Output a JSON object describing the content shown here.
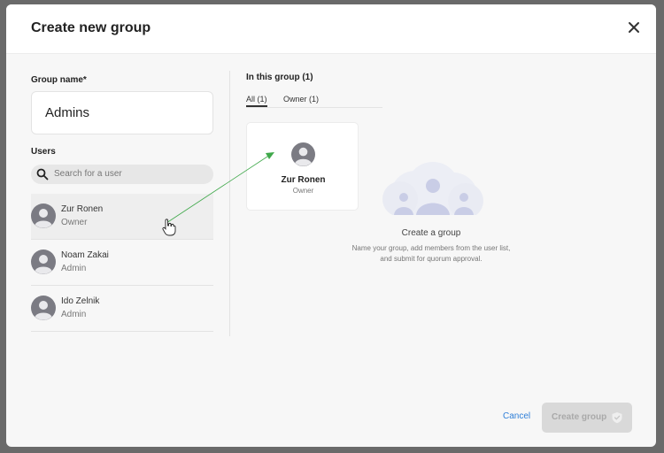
{
  "dialog": {
    "title": "Create new group",
    "group_name_label": "Group name*",
    "group_name_value": "Admins",
    "users_label": "Users",
    "search_placeholder": "Search for a user",
    "users": [
      {
        "name": "Zur Ronen",
        "role": "Owner",
        "selected": true
      },
      {
        "name": "Noam Zakai",
        "role": "Admin",
        "selected": false
      },
      {
        "name": "Ido Zelnik",
        "role": "Admin",
        "selected": false
      }
    ],
    "in_group_label": "In this group (1)",
    "tabs": [
      {
        "label": "All (1)",
        "active": true
      },
      {
        "label": "Owner (1)",
        "active": false
      }
    ],
    "members": [
      {
        "name": "Zur Ronen",
        "role": "Owner"
      }
    ],
    "empty_state": {
      "title": "Create a group",
      "description_line1": "Name your group, add members from the user list,",
      "description_line2": "and submit for quorum approval."
    },
    "footer": {
      "cancel_label": "Cancel",
      "create_label": "Create group"
    }
  },
  "colors": {
    "link": "#2f7fd8",
    "disabled_button": "#d9d9d9",
    "drag_arrow": "#3fa84a",
    "avatar": "#7b7b83"
  },
  "icons": [
    "close-icon",
    "search-icon",
    "user-avatar-icon",
    "group-illustration-icon",
    "shield-check-icon",
    "hand-cursor-icon"
  ]
}
